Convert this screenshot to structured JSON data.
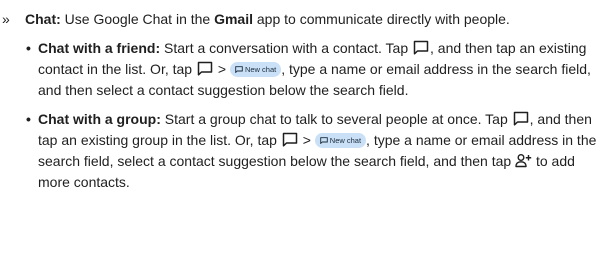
{
  "intro": {
    "arrow": "»",
    "label": "Chat:",
    "t1": " Use Google Chat in the ",
    "app": "Gmail",
    "t2": " app to communicate directly with people."
  },
  "items": [
    {
      "bullet": "•",
      "label": "Chat with a friend:",
      "t1": " Start a conversation with a contact. Tap ",
      "t2": ", and then tap an existing contact in the list. Or, tap ",
      "t3": " > ",
      "t4": ", type a name or email address in the search field, and then select a contact suggestion below the search field."
    },
    {
      "bullet": "•",
      "label": "Chat with a group:",
      "t1": " Start a group chat to talk to several people at once. Tap ",
      "t2": ", and then tap an existing group in the list. Or, tap ",
      "t3": " > ",
      "t4": ", type a name or email address in the search field, select a contact suggestion below the search field, and then tap ",
      "t5": " to add more contacts."
    }
  ],
  "chip_label": "New chat",
  "icons": {
    "chat": "chat-bubble-icon",
    "new_chat": "new-chat-chip",
    "add_people": "add-people-icon"
  }
}
